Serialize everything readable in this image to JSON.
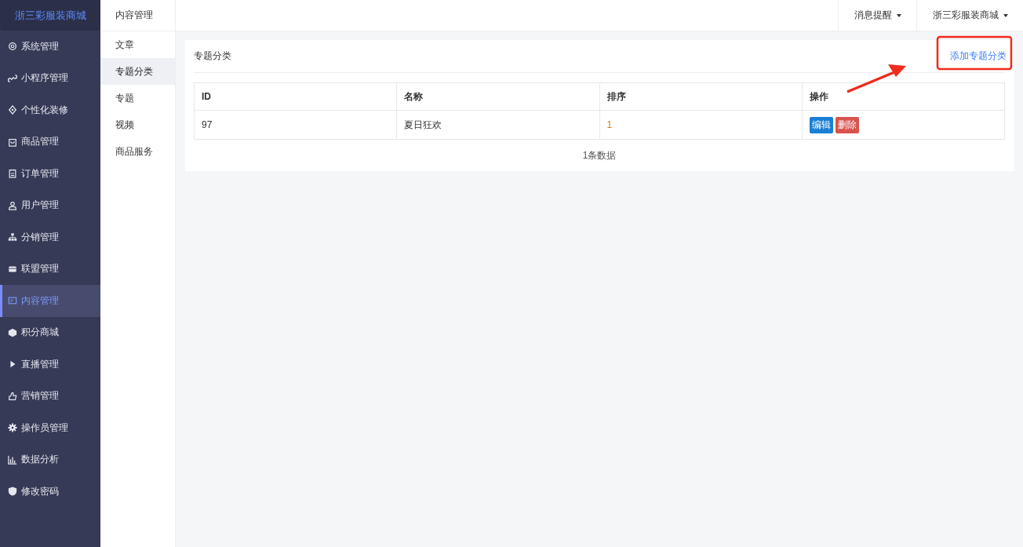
{
  "brand": "浙三彩服装商城",
  "nav": [
    {
      "label": "系统管理",
      "selected": false
    },
    {
      "label": "小程序管理",
      "selected": false
    },
    {
      "label": "个性化装修",
      "selected": false
    },
    {
      "label": "商品管理",
      "selected": false
    },
    {
      "label": "订单管理",
      "selected": false
    },
    {
      "label": "用户管理",
      "selected": false
    },
    {
      "label": "分销管理",
      "selected": false
    },
    {
      "label": "联盟管理",
      "selected": false
    },
    {
      "label": "内容管理",
      "selected": true
    },
    {
      "label": "积分商城",
      "selected": false
    },
    {
      "label": "直播管理",
      "selected": false
    },
    {
      "label": "营销管理",
      "selected": false
    },
    {
      "label": "操作员管理",
      "selected": false
    },
    {
      "label": "数据分析",
      "selected": false
    },
    {
      "label": "修改密码",
      "selected": false
    }
  ],
  "subnav": {
    "title": "内容管理",
    "items": [
      {
        "label": "文章",
        "selected": false
      },
      {
        "label": "专题分类",
        "selected": true
      },
      {
        "label": "专题",
        "selected": false
      },
      {
        "label": "视频",
        "selected": false
      },
      {
        "label": "商品服务",
        "selected": false
      }
    ]
  },
  "topbar": {
    "menus": [
      "消息提醒",
      "浙三彩服装商城"
    ]
  },
  "panel": {
    "title": "专题分类",
    "add_link": "添加专题分类",
    "table": {
      "columns": [
        "ID",
        "名称",
        "排序",
        "操作"
      ],
      "rows": [
        {
          "id": "97",
          "name": "夏日狂欢",
          "order": "1",
          "actions": [
            "编辑",
            "删除"
          ]
        }
      ]
    },
    "footer": "1条数据"
  }
}
